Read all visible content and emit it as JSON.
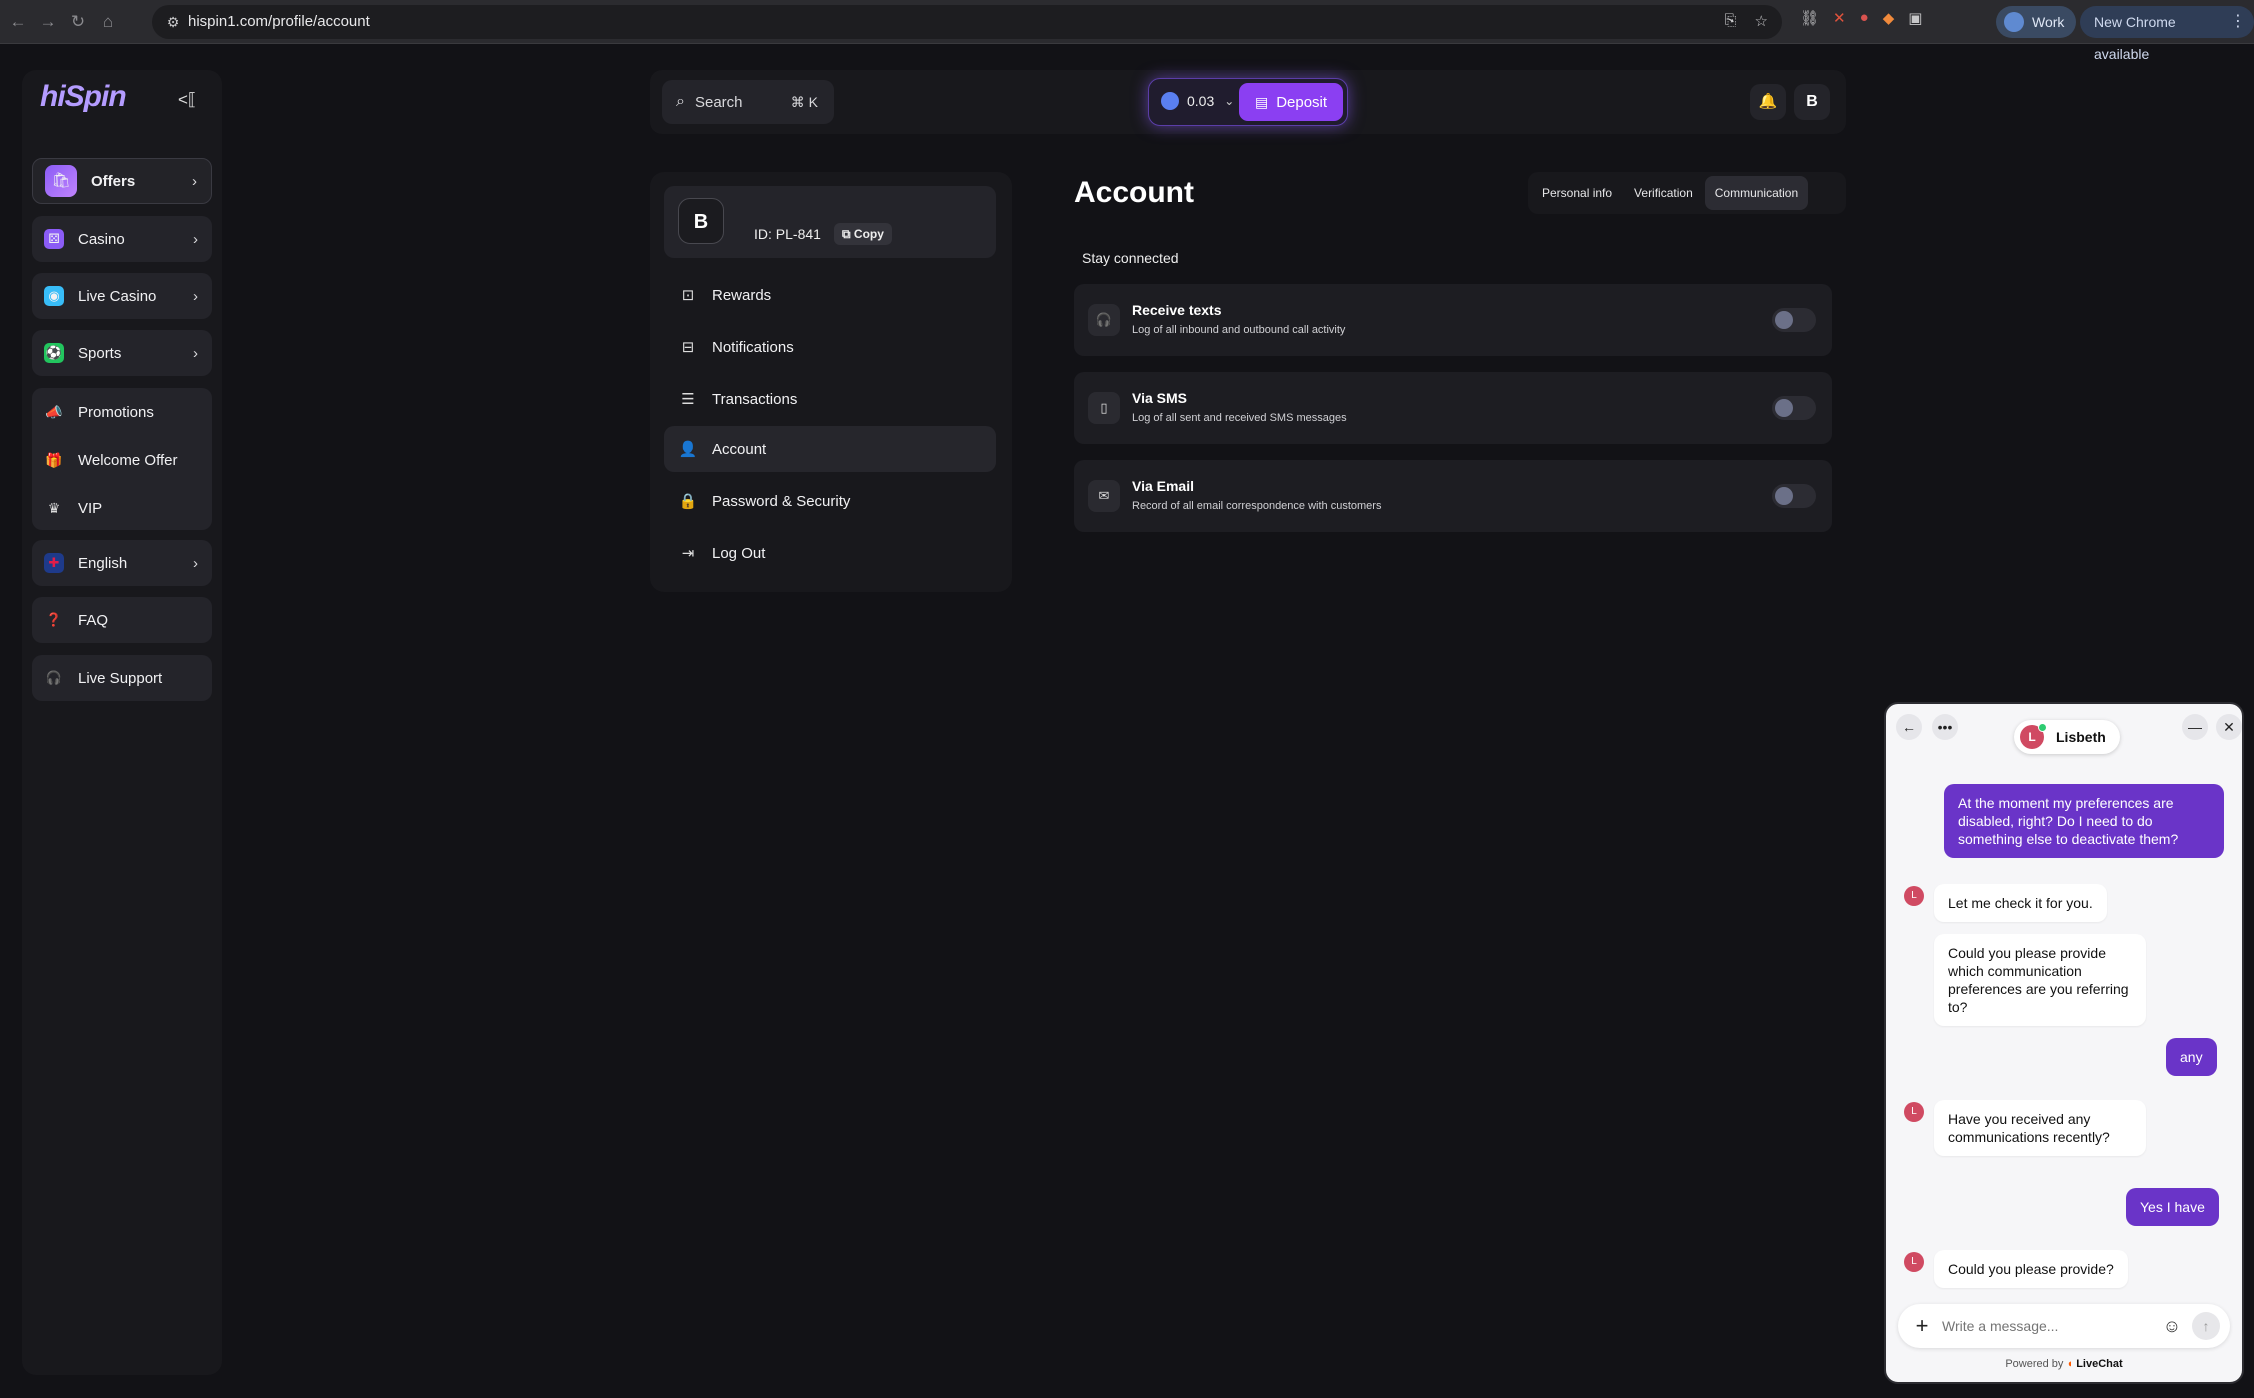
{
  "browser": {
    "url": "hispin1.com/profile/account",
    "profile_label": "Work",
    "update_label": "New Chrome available"
  },
  "sidebar": {
    "logo": "hiSpin",
    "items": [
      {
        "label": "Offers",
        "icon": "gift-box-icon"
      },
      {
        "label": "Casino",
        "icon": "dice-icon"
      },
      {
        "label": "Live Casino",
        "icon": "live-icon"
      },
      {
        "label": "Sports",
        "icon": "ball-icon"
      }
    ],
    "group": [
      {
        "label": "Promotions",
        "icon": "megaphone-icon"
      },
      {
        "label": "Welcome Offer",
        "icon": "gift-icon"
      },
      {
        "label": "VIP",
        "icon": "crown-icon"
      }
    ],
    "language": "English",
    "faq": "FAQ",
    "support": "Live Support"
  },
  "topbar": {
    "search_label": "Search",
    "search_shortcut": "⌘ K",
    "balance": "0.03",
    "deposit_label": "Deposit",
    "user_initial": "B"
  },
  "profile_menu": {
    "user_initial": "B",
    "user_id": "ID: PL-841",
    "copy_label": "Copy",
    "items": [
      {
        "label": "Rewards",
        "icon": "rewards-icon"
      },
      {
        "label": "Notifications",
        "icon": "inbox-icon"
      },
      {
        "label": "Transactions",
        "icon": "receipt-icon"
      },
      {
        "label": "Account",
        "icon": "user-icon"
      },
      {
        "label": "Password & Security",
        "icon": "lock-icon"
      },
      {
        "label": "Log Out",
        "icon": "logout-icon"
      }
    ],
    "active": "Account"
  },
  "account": {
    "title": "Account",
    "tabs": [
      "Personal info",
      "Verification",
      "Communication"
    ],
    "active_tab": "Communication",
    "section_label": "Stay connected",
    "preferences": [
      {
        "title": "Receive texts",
        "desc": "Log of all inbound and outbound call activity",
        "enabled": false,
        "icon": "headset-icon"
      },
      {
        "title": "Via SMS",
        "desc": "Log of all sent and received SMS messages",
        "enabled": false,
        "icon": "phone-icon"
      },
      {
        "title": "Via Email",
        "desc": "Record of all email correspondence with customers",
        "enabled": false,
        "icon": "envelope-icon"
      }
    ]
  },
  "chat": {
    "agent_name": "Lisbeth",
    "agent_initial": "L",
    "messages": [
      {
        "from": "user",
        "text": "At the moment my preferences are disabled, right? Do I need to do something else to deactivate them?"
      },
      {
        "from": "agent",
        "text": "Let me check it for you."
      },
      {
        "from": "agent",
        "text": "Could you please provide which communication preferences are you referring to?"
      },
      {
        "from": "user",
        "text": "any"
      },
      {
        "from": "agent",
        "text": "Have you received any communications recently?"
      },
      {
        "from": "user",
        "text": "Yes I have"
      },
      {
        "from": "agent",
        "text": "Could you please provide?"
      }
    ],
    "input_placeholder": "Write a message...",
    "powered_by": "Powered by",
    "brand": "LiveChat"
  },
  "colors": {
    "accent": "#8b3ff2",
    "chat_bubble_user": "#6a34c8",
    "background": "#121216"
  }
}
